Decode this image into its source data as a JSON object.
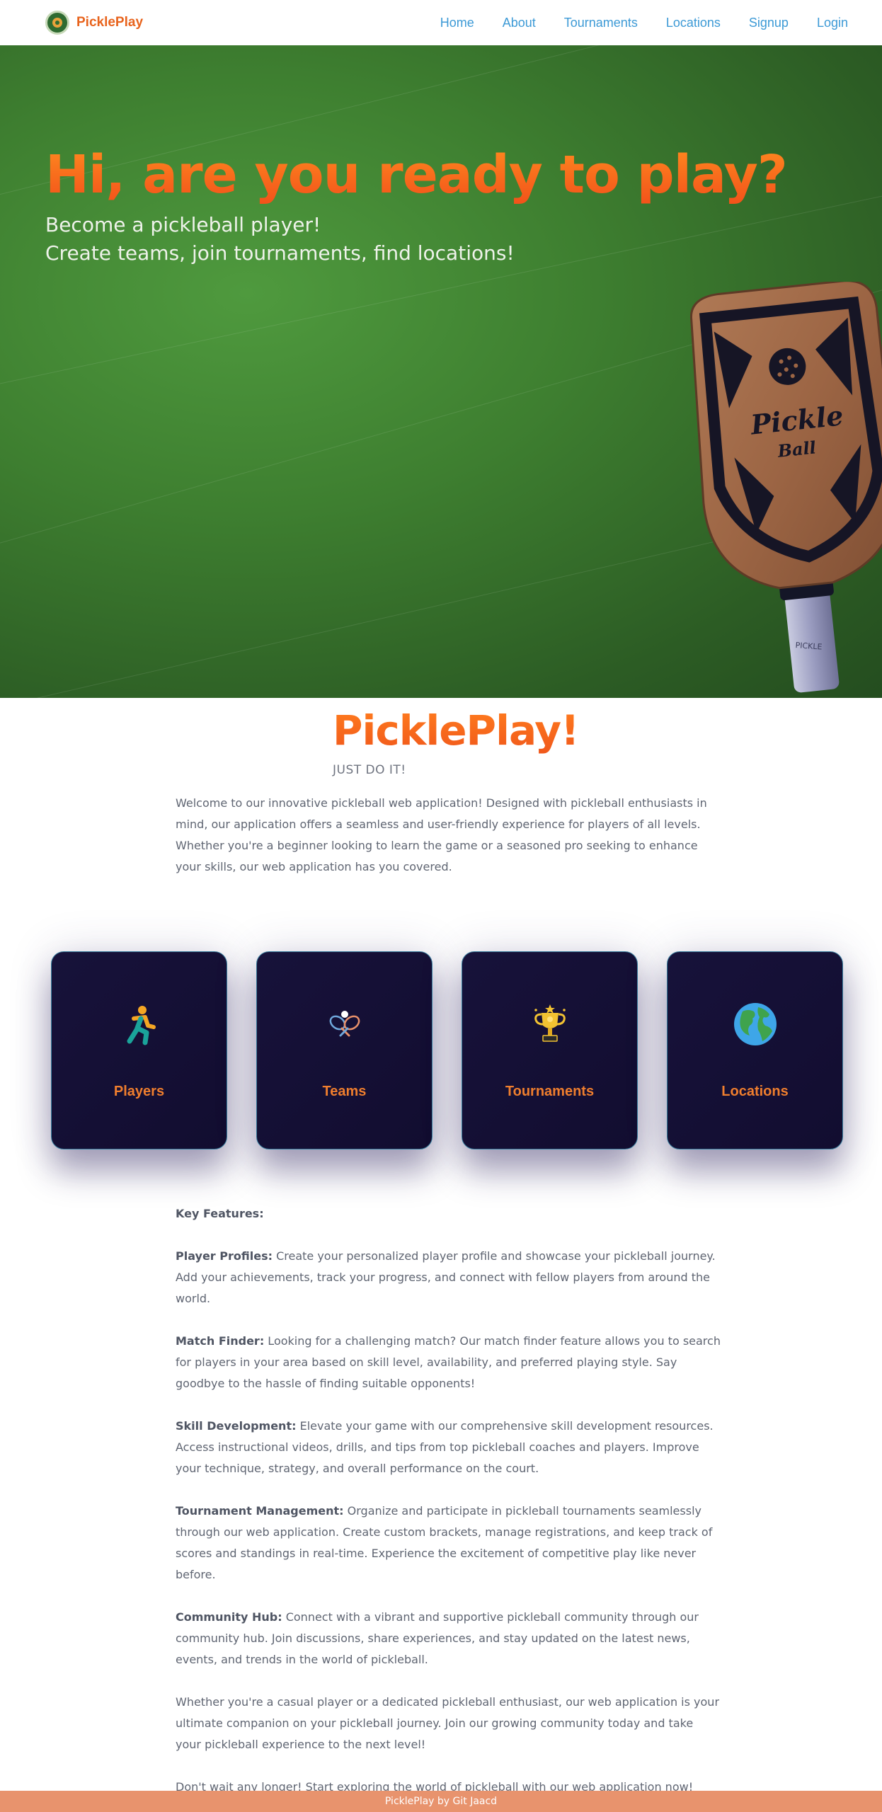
{
  "nav": {
    "brand": "PicklePlay",
    "links": [
      {
        "label": "Home"
      },
      {
        "label": "About"
      },
      {
        "label": "Tournaments"
      },
      {
        "label": "Locations"
      },
      {
        "label": "Signup"
      },
      {
        "label": "Login"
      }
    ]
  },
  "hero": {
    "title": "Hi, are you ready to play?",
    "subtitle_line1": "Become a pickleball player!",
    "subtitle_line2": "Create teams, join tournaments, find locations!",
    "paddle_text_1": "Pickle",
    "paddle_text_2": "Ball",
    "paddle_grip_text": "PICKLE"
  },
  "intro": {
    "title": "PicklePlay!",
    "tagline": "JUST DO IT!",
    "text": "Welcome to our innovative pickleball web application! Designed with pickleball enthusiasts in mind, our application offers a seamless and user-friendly experience for players of all levels. Whether you're a beginner looking to learn the game or a seasoned pro seeking to enhance your skills, our web application has you covered."
  },
  "cards": [
    {
      "label": "Players",
      "icon": "runner-icon"
    },
    {
      "label": "Teams",
      "icon": "crossed-paddles-icon"
    },
    {
      "label": "Tournaments",
      "icon": "trophy-icon"
    },
    {
      "label": "Locations",
      "icon": "globe-icon"
    }
  ],
  "features": {
    "heading": "Key Features:",
    "items": [
      {
        "title": "Player Profiles:",
        "text": " Create your personalized player profile and showcase your pickleball journey. Add your achievements, track your progress, and connect with fellow players from around the world."
      },
      {
        "title": "Match Finder:",
        "text": " Looking for a challenging match? Our match finder feature allows you to search for players in your area based on skill level, availability, and preferred playing style. Say goodbye to the hassle of finding suitable opponents!"
      },
      {
        "title": "Skill Development:",
        "text": " Elevate your game with our comprehensive skill development resources. Access instructional videos, drills, and tips from top pickleball coaches and players. Improve your technique, strategy, and overall performance on the court."
      },
      {
        "title": "Tournament Management:",
        "text": " Organize and participate in pickleball tournaments seamlessly through our web application. Create custom brackets, manage registrations, and keep track of scores and standings in real-time. Experience the excitement of competitive play like never before."
      },
      {
        "title": "Community Hub:",
        "text": " Connect with a vibrant and supportive pickleball community through our community hub. Join discussions, share experiences, and stay updated on the latest news, events, and trends in the world of pickleball."
      }
    ],
    "closing_1": "Whether you're a casual player or a dedicated pickleball enthusiast, our web application is your ultimate companion on your pickleball journey. Join our growing community today and take your pickleball experience to the next level!",
    "closing_2": "Don't wait any longer! Start exploring the world of pickleball with our web application now!"
  },
  "footer": {
    "text": "PicklePlay by Git Jaacd"
  },
  "colors": {
    "brand_orange": "#e8631c",
    "nav_link": "#3d9ad6",
    "card_bg": "#17123a",
    "footer_bg": "#e8936d"
  }
}
